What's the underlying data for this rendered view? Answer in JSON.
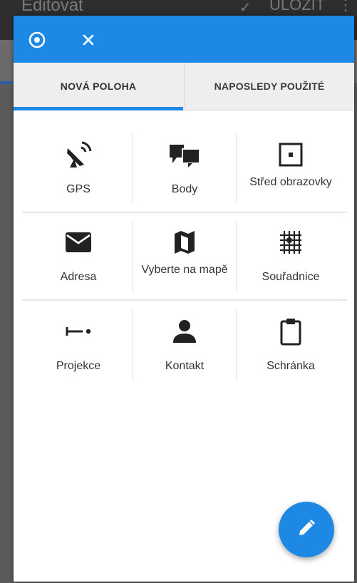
{
  "background": {
    "title": "Editovat",
    "save_label": "ULOŽIT"
  },
  "dialog": {
    "header": {
      "target_icon": "target-icon",
      "close_icon": "close-icon"
    },
    "tabs": [
      {
        "label": "NOVÁ POLOHA",
        "selected": true
      },
      {
        "label": "NAPOSLEDY POUŽITÉ",
        "selected": false
      }
    ],
    "items": [
      {
        "icon": "satellite-dish-icon",
        "label": "GPS"
      },
      {
        "icon": "points-icon",
        "label": "Body"
      },
      {
        "icon": "screen-center-icon",
        "label": "Střed obrazovky"
      },
      {
        "icon": "envelope-icon",
        "label": "Adresa"
      },
      {
        "icon": "map-icon",
        "label": "Vyberte na mapě"
      },
      {
        "icon": "grid-coordinates-icon",
        "label": "Souřadnice"
      },
      {
        "icon": "projection-icon",
        "label": "Projekce"
      },
      {
        "icon": "person-icon",
        "label": "Kontakt"
      },
      {
        "icon": "clipboard-icon",
        "label": "Schránka"
      }
    ],
    "fab_icon": "pencil-icon"
  },
  "colors": {
    "accent": "#1e88e5",
    "overlay": "#5b5b5b"
  }
}
